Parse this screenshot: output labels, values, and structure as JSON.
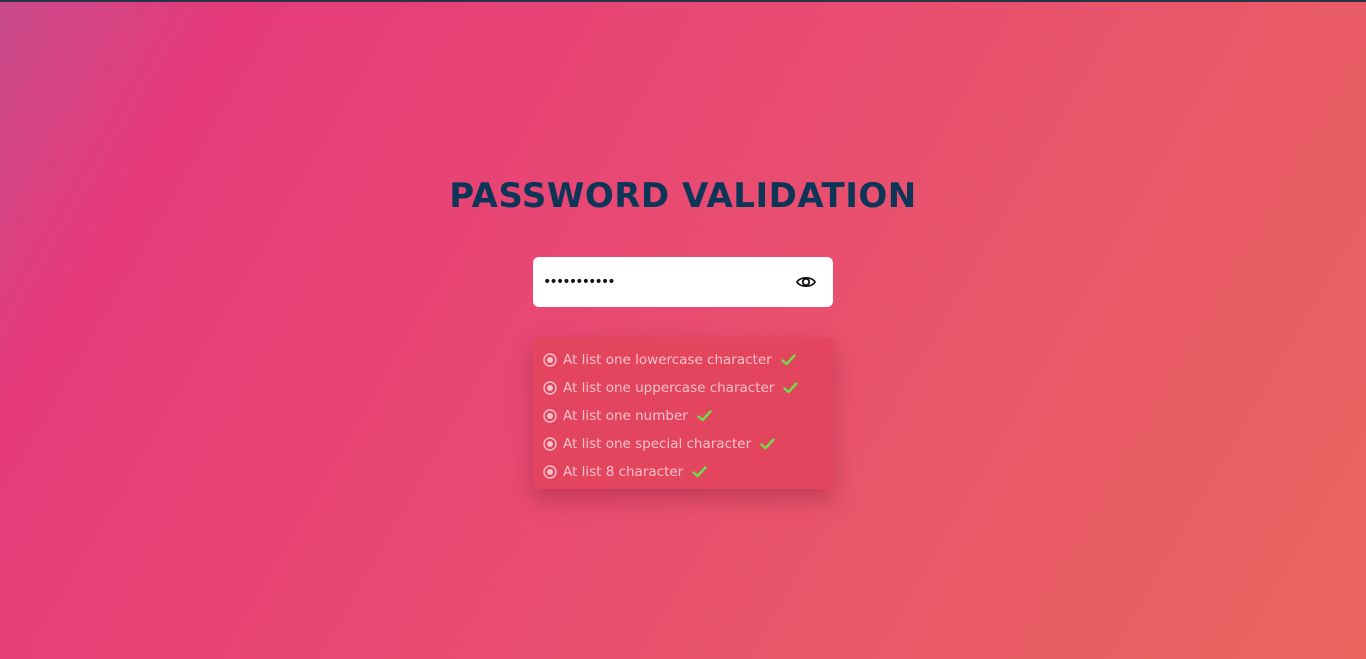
{
  "page": {
    "title": "PASSWORD VALIDATION"
  },
  "password_field": {
    "masked_value": "•••••••••••",
    "visibility_icon": "eye-icon"
  },
  "requirements": [
    {
      "label": "At list one lowercase character",
      "met": true
    },
    {
      "label": "At list one uppercase character",
      "met": true
    },
    {
      "label": "At list one number",
      "met": true
    },
    {
      "label": "At list one special character",
      "met": true
    },
    {
      "label": "At list 8 character",
      "met": true
    }
  ],
  "colors": {
    "title": "#0d3558",
    "check": "#6be04a",
    "panel": "#e4455e",
    "rule_text": "#f6c1c9"
  }
}
